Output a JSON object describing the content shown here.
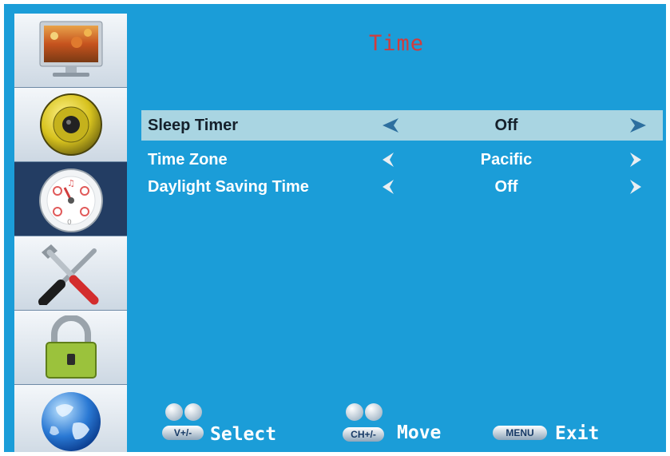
{
  "title": "Time",
  "sidebar": {
    "items": [
      {
        "name": "picture",
        "icon": "picture-icon"
      },
      {
        "name": "sound",
        "icon": "speaker-icon"
      },
      {
        "name": "time",
        "icon": "clock-icon",
        "active": true
      },
      {
        "name": "setup",
        "icon": "tools-icon"
      },
      {
        "name": "lock",
        "icon": "padlock-icon"
      },
      {
        "name": "channel",
        "icon": "globe-icon"
      }
    ]
  },
  "menu": {
    "rows": [
      {
        "label": "Sleep Timer",
        "value": "Off",
        "selected": true
      },
      {
        "label": "Time Zone",
        "value": "Pacific"
      },
      {
        "label": "Daylight Saving Time",
        "value": "Off"
      }
    ]
  },
  "footer": {
    "select_key": "V+/-",
    "select_label": "Select",
    "move_key": "CH+/-",
    "move_label": "Move",
    "exit_key": "MENU",
    "exit_label": "Exit"
  },
  "colors": {
    "background": "#1b9dd8",
    "title": "#d13c3c",
    "selected_row": "#a9d5e2",
    "active_sidebar": "#233d63"
  }
}
